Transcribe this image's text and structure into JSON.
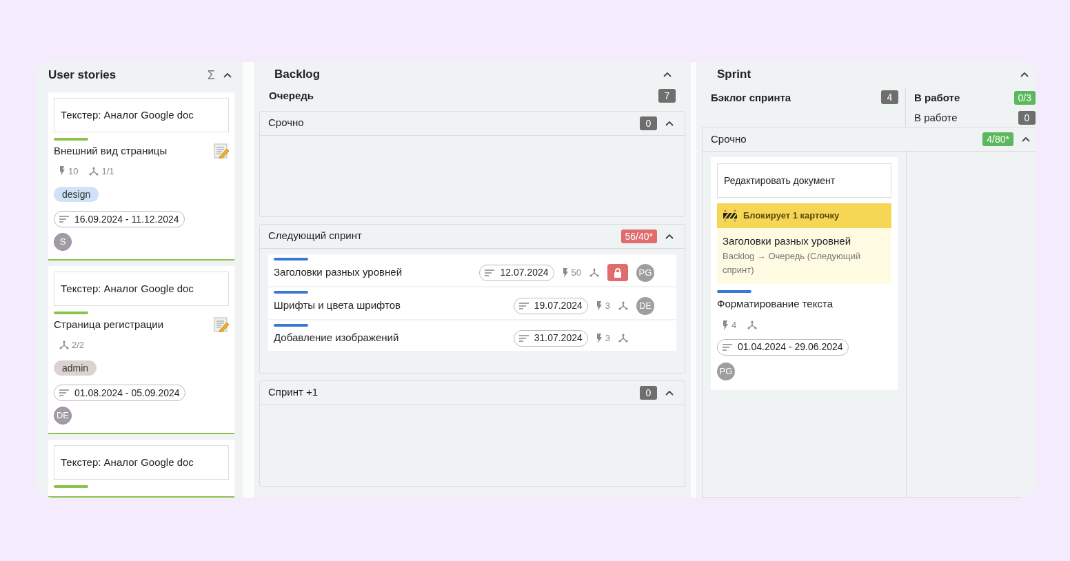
{
  "user_stories": {
    "title": "User stories",
    "sum_symbol": "Σ",
    "cards": [
      {
        "parent": "Текстер: Аналог Google doc",
        "title": "Внешний вид страницы",
        "color": "#8bc34a",
        "points": "10",
        "subtasks": "1/1",
        "tag": {
          "label": "design",
          "color": "#cfe2f7"
        },
        "dates": "16.09.2024 - 11.12.2024",
        "avatar": "S"
      },
      {
        "parent": "Текстер: Аналог Google doc",
        "title": "Страница регистрации",
        "color": "#8bc34a",
        "subtasks": "2/2",
        "tag": {
          "label": "admin",
          "color": "#dcd3d1"
        },
        "dates": "01.08.2024 - 05.09.2024",
        "avatar": "DE"
      },
      {
        "parent": "Текстер: Аналог Google doc",
        "color": "#8bc34a"
      }
    ]
  },
  "backlog": {
    "title": "Backlog",
    "queue": {
      "label": "Очередь",
      "count": "7"
    },
    "lanes": [
      {
        "title": "Срочно",
        "count": "0",
        "color": "#6e6e6e",
        "expanded": true
      },
      {
        "title": "Следующий спринт",
        "count": "56/40*",
        "color": "#e06c6c",
        "expanded": true,
        "rows": [
          {
            "title": "Заголовки разных уровней",
            "color": "#3a78d6",
            "date": "12.07.2024",
            "points": "50",
            "blocked": true,
            "avatar": "PG"
          },
          {
            "title": "Шрифты и цвета шрифтов",
            "color": "#3a78d6",
            "date": "19.07.2024",
            "points": "3",
            "blocked": false,
            "avatar": "DE"
          },
          {
            "title": "Добавление изображений",
            "color": "#3a78d6",
            "date": "31.07.2024",
            "points": "3",
            "blocked": false
          }
        ]
      },
      {
        "title": "Спринт +1",
        "count": "0",
        "color": "#6e6e6e",
        "expanded": true
      }
    ]
  },
  "sprint": {
    "title": "Sprint",
    "backlog": {
      "label": "Бэклог спринта",
      "count": "4",
      "color": "#6e6e6e"
    },
    "in_progress": [
      {
        "label": "В работе",
        "count": "0/3",
        "color": "#5cb85c",
        "bold": true
      },
      {
        "label": "В работе",
        "count": "0",
        "color": "#6e6e6e",
        "bold": false
      }
    ],
    "lane": {
      "title": "Срочно",
      "count": "4/80*",
      "color": "#5cb85c",
      "expanded": true,
      "card": {
        "parent": "Редактировать документ",
        "blocker": {
          "label": "Блокирует 1 карточку",
          "title": "Заголовки разных уровней",
          "path": "Backlog → Очередь (Следующий спринт)"
        },
        "title": "Форматирование текста",
        "color": "#3a78d6",
        "points": "4",
        "dates": "01.04.2024 - 29.06.2024",
        "avatar": "PG"
      }
    }
  }
}
